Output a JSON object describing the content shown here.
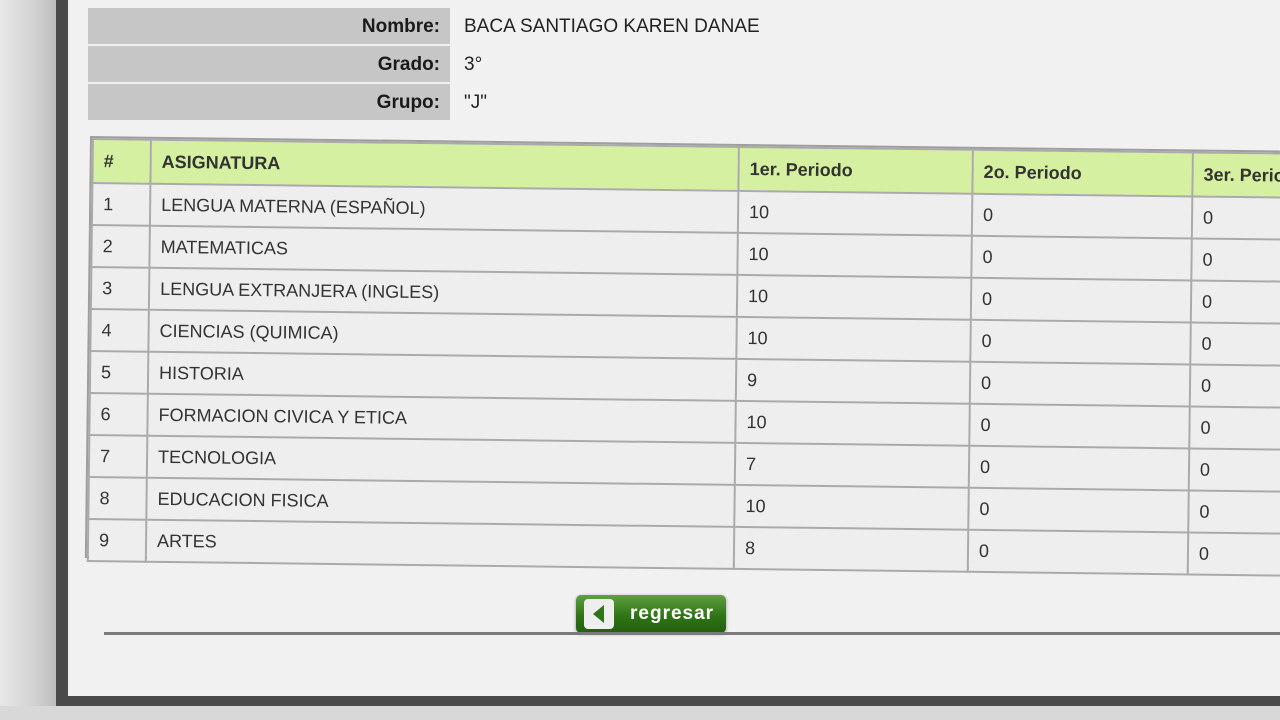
{
  "student": {
    "nombre_label": "Nombre:",
    "nombre": "BACA SANTIAGO KAREN DANAE",
    "grado_label": "Grado:",
    "grado": "3°",
    "grupo_label": "Grupo:",
    "grupo": "\"J\""
  },
  "table": {
    "headers": [
      "#",
      "ASIGNATURA",
      "1er. Periodo",
      "2o. Periodo",
      "3er. Perio"
    ],
    "rows": [
      {
        "num": "1",
        "subject": "LENGUA MATERNA (ESPAÑOL)",
        "p1": "10",
        "p2": "0",
        "p3": "0"
      },
      {
        "num": "2",
        "subject": "MATEMATICAS",
        "p1": "10",
        "p2": "0",
        "p3": "0"
      },
      {
        "num": "3",
        "subject": "LENGUA EXTRANJERA (INGLES)",
        "p1": "10",
        "p2": "0",
        "p3": "0"
      },
      {
        "num": "4",
        "subject": "CIENCIAS (QUIMICA)",
        "p1": "10",
        "p2": "0",
        "p3": "0"
      },
      {
        "num": "5",
        "subject": "HISTORIA",
        "p1": "9",
        "p2": "0",
        "p3": "0"
      },
      {
        "num": "6",
        "subject": "FORMACION CIVICA Y ETICA",
        "p1": "10",
        "p2": "0",
        "p3": "0"
      },
      {
        "num": "7",
        "subject": "TECNOLOGIA",
        "p1": "7",
        "p2": "0",
        "p3": "0"
      },
      {
        "num": "8",
        "subject": "EDUCACION FISICA",
        "p1": "10",
        "p2": "0",
        "p3": "0"
      },
      {
        "num": "9",
        "subject": "ARTES",
        "p1": "8",
        "p2": "0",
        "p3": "0"
      }
    ]
  },
  "back_button": {
    "label": "regresar",
    "icon": "back-arrow-icon"
  },
  "colors": {
    "header_bg": "#d5f0a0",
    "button_green": "#2f7416",
    "label_bg": "#c6c6c6"
  }
}
